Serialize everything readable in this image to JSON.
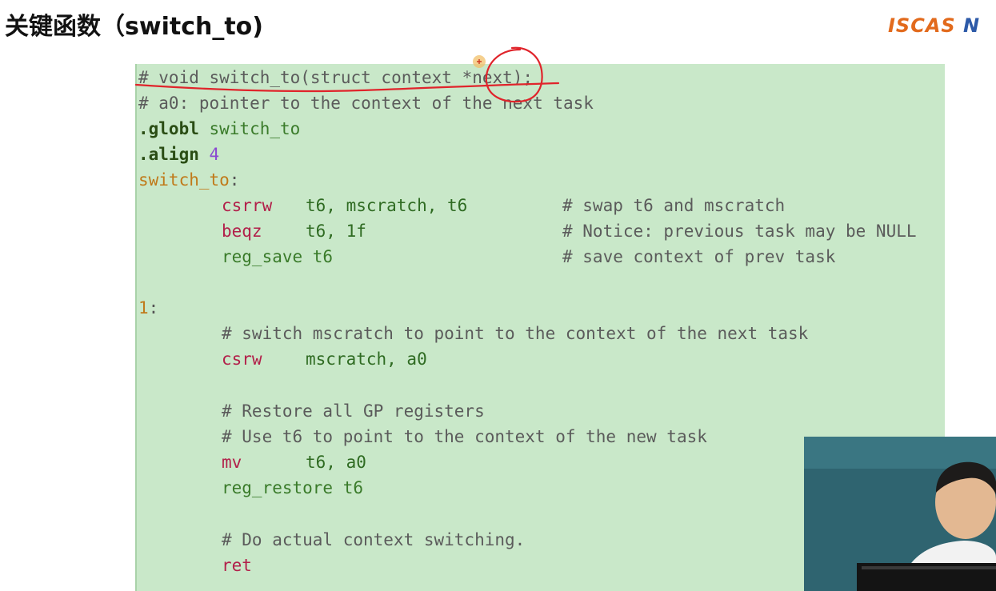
{
  "slide": {
    "title": "关键函数（switch_to)",
    "logo_part1": "ISCAS",
    "logo_part2": "N"
  },
  "code": {
    "line1": "# void switch_to(struct context *next);",
    "line2": "# a0: pointer to the context of the next task",
    "line3_directive": ".globl",
    "line3_arg": " switch_to",
    "line4_directive": ".align",
    "line4_arg": "4",
    "line5_label": "switch_to",
    "line5_colon": ":",
    "line6_instr": "csrrw",
    "line6_args": "t6, mscratch, t6",
    "line6_comment": "# swap t6 and mscratch",
    "line7_instr": "beqz",
    "line7_args": "t6, 1f",
    "line7_comment": "# Notice: previous task may be NULL",
    "line8_macro": "reg_save t6",
    "line8_comment": "# save context of prev task",
    "line9_label": "1",
    "line9_colon": ":",
    "line10": "# switch mscratch to point to the context of the next task",
    "line11_instr": "csrw",
    "line11_args": "mscratch, a0",
    "line12": "# Restore all GP registers",
    "line13": "# Use t6 to point to the context of the new task",
    "line14_instr": "mv",
    "line14_args": "t6, a0",
    "line15_macro": "reg_restore t6",
    "line16": "# Do actual context switching.",
    "line17_instr": "ret"
  },
  "colors": {
    "panel_background": "#c9e8c9",
    "annotation_red": "#e0242b",
    "logo_orange": "#e26a1c",
    "logo_blue": "#2d5aa8"
  }
}
